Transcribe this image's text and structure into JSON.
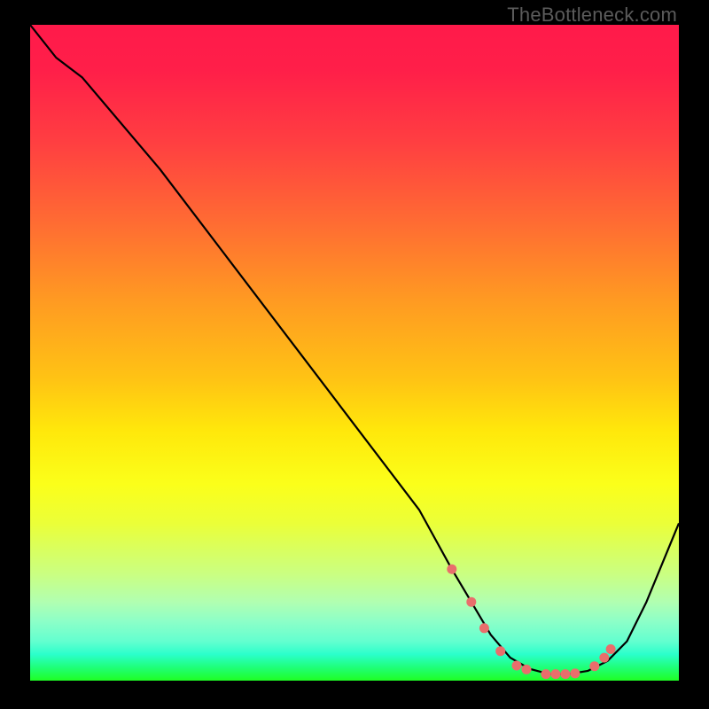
{
  "watermark": "TheBottleneck.com",
  "chart_data": {
    "type": "line",
    "title": "",
    "xlabel": "",
    "ylabel": "",
    "xlim": [
      0,
      100
    ],
    "ylim": [
      0,
      100
    ],
    "series": [
      {
        "name": "bottleneck-curve",
        "x": [
          0,
          4,
          8,
          20,
          30,
          40,
          50,
          60,
          65,
          68,
          71,
          74,
          77,
          80,
          83,
          86,
          89,
          92,
          95,
          100
        ],
        "y": [
          100,
          95,
          92,
          78,
          65,
          52,
          39,
          26,
          17,
          12,
          7,
          3.5,
          1.8,
          1,
          1,
          1.5,
          3,
          6,
          12,
          24
        ]
      }
    ],
    "markers": {
      "name": "optimal-zone",
      "x": [
        65,
        68,
        70,
        72.5,
        75,
        76.5,
        79.5,
        81,
        82.5,
        84,
        87,
        88.5,
        89.5
      ],
      "y": [
        17,
        12,
        8,
        4.5,
        2.3,
        1.7,
        1.0,
        1.0,
        1.0,
        1.1,
        2.2,
        3.5,
        4.8
      ]
    }
  }
}
